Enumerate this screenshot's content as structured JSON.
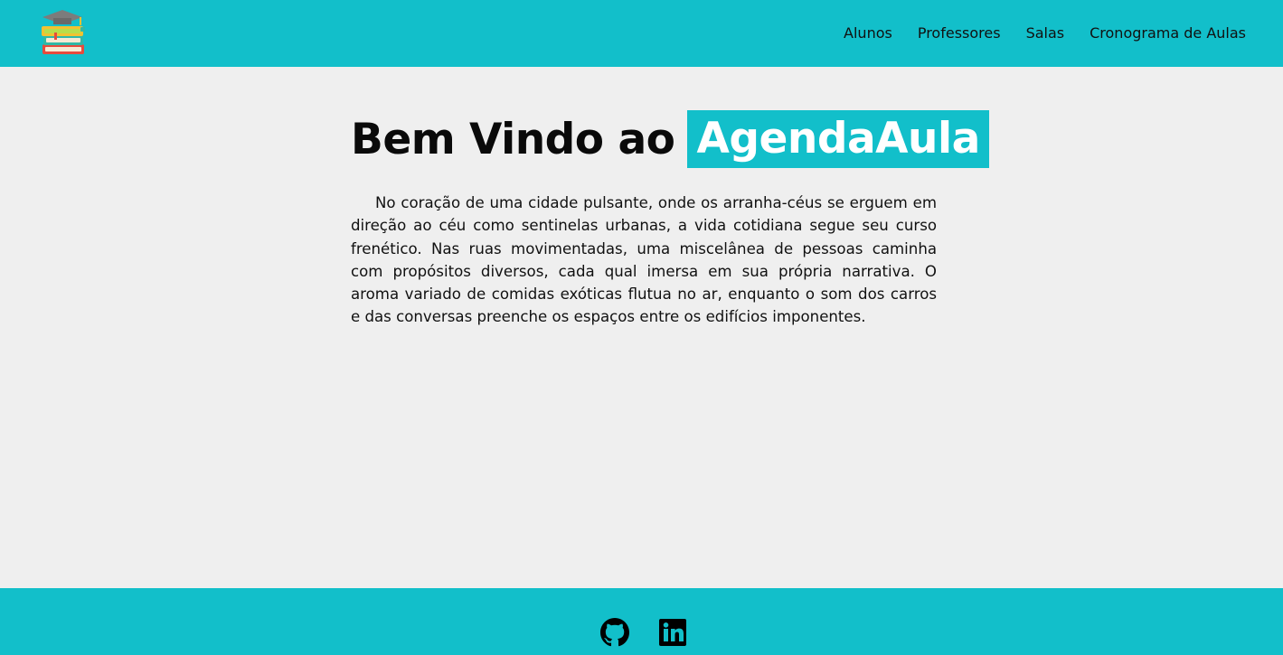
{
  "header": {
    "logo_icon": "books-graduation-cap-icon",
    "nav": [
      {
        "label": "Alunos"
      },
      {
        "label": "Professores"
      },
      {
        "label": "Salas"
      },
      {
        "label": "Cronograma de Aulas"
      }
    ]
  },
  "main": {
    "title_prefix": "Bem Vindo ao",
    "title_brand": "AgendaAula",
    "paragraph": "No coração de uma cidade pulsante, onde os arranha-céus se erguem em direção ao céu como sentinelas urbanas, a vida cotidiana segue seu curso frenético. Nas ruas movimentadas, uma miscelânea de pessoas caminha com propósitos diversos, cada qual imersa em sua própria narrativa. O aroma variado de comidas exóticas flutua no ar, enquanto o som dos carros e das conversas preenche os espaços entre os edifícios imponentes."
  },
  "footer": {
    "icons": [
      "github-icon",
      "linkedin-icon"
    ]
  },
  "colors": {
    "accent": "#12bfca",
    "background": "#efefef",
    "text": "#111111"
  }
}
